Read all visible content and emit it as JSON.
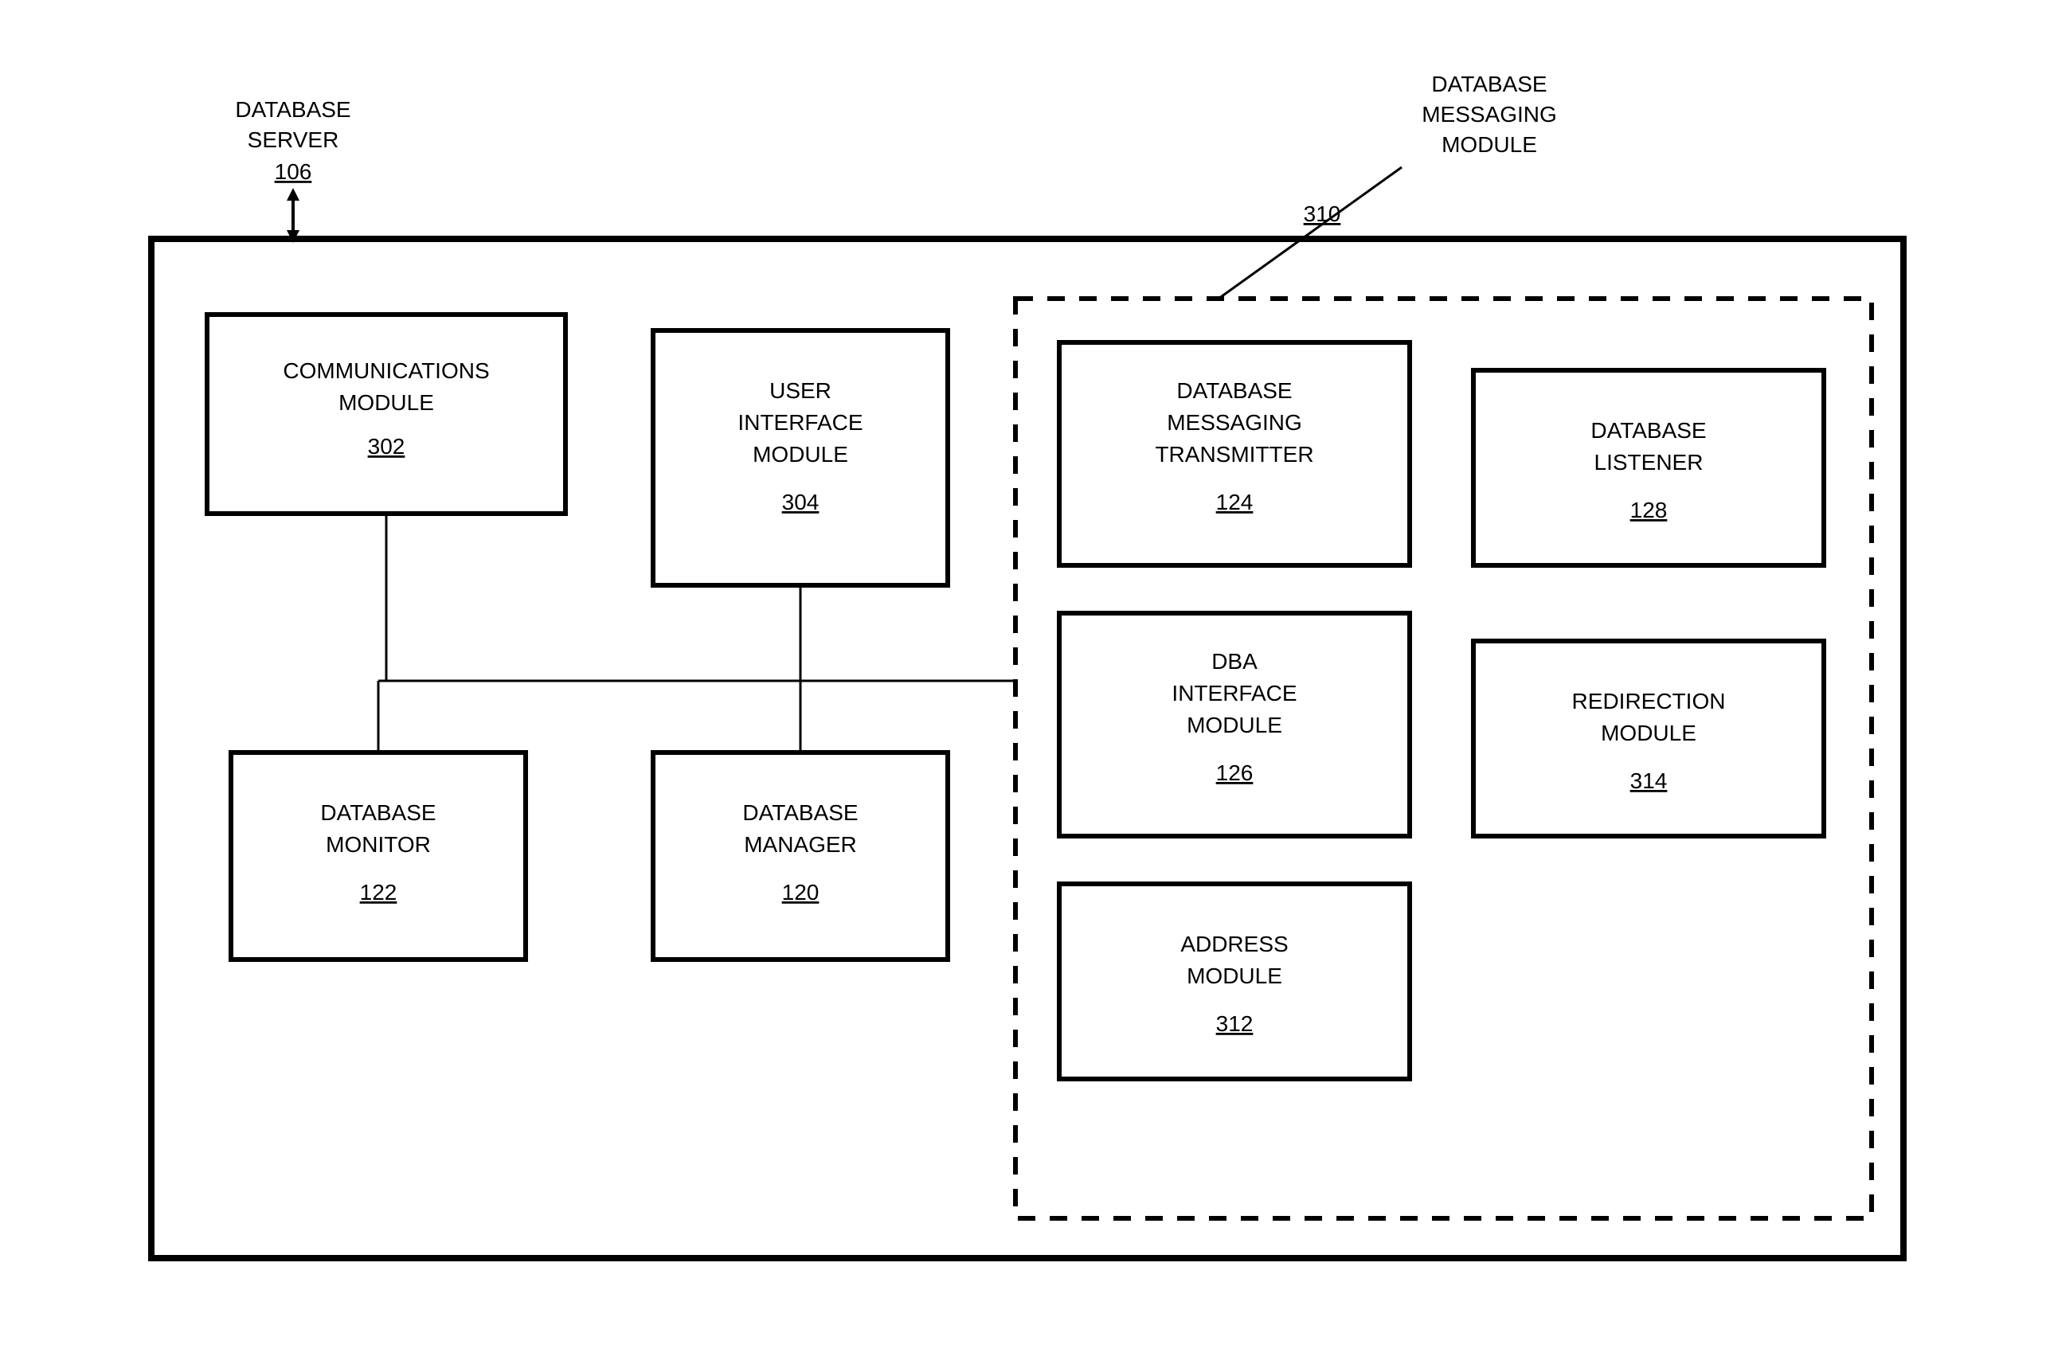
{
  "outerLabel": {
    "line1": "DATABASE",
    "line2": "SERVER",
    "ref": "106"
  },
  "messagingLabel": {
    "line1": "DATABASE",
    "line2": "MESSAGING",
    "line3": "MODULE",
    "ref": "310"
  },
  "comm": {
    "line1": "COMMUNICATIONS",
    "line2": "MODULE",
    "ref": "302"
  },
  "ui": {
    "line1": "USER",
    "line2": "INTERFACE",
    "line3": "MODULE",
    "ref": "304"
  },
  "dbmon": {
    "line1": "DATABASE",
    "line2": "MONITOR",
    "ref": "122"
  },
  "dbmgr": {
    "line1": "DATABASE",
    "line2": "MANAGER",
    "ref": "120"
  },
  "msgtx": {
    "line1": "DATABASE",
    "line2": "MESSAGING",
    "line3": "TRANSMITTER",
    "ref": "124"
  },
  "listener": {
    "line1": "DATABASE",
    "line2": "LISTENER",
    "ref": "128"
  },
  "dbaif": {
    "line1": "DBA",
    "line2": "INTERFACE",
    "line3": "MODULE",
    "ref": "126"
  },
  "redir": {
    "line1": "REDIRECTION",
    "line2": "MODULE",
    "ref": "314"
  },
  "addr": {
    "line1": "ADDRESS",
    "line2": "MODULE",
    "ref": "312"
  }
}
